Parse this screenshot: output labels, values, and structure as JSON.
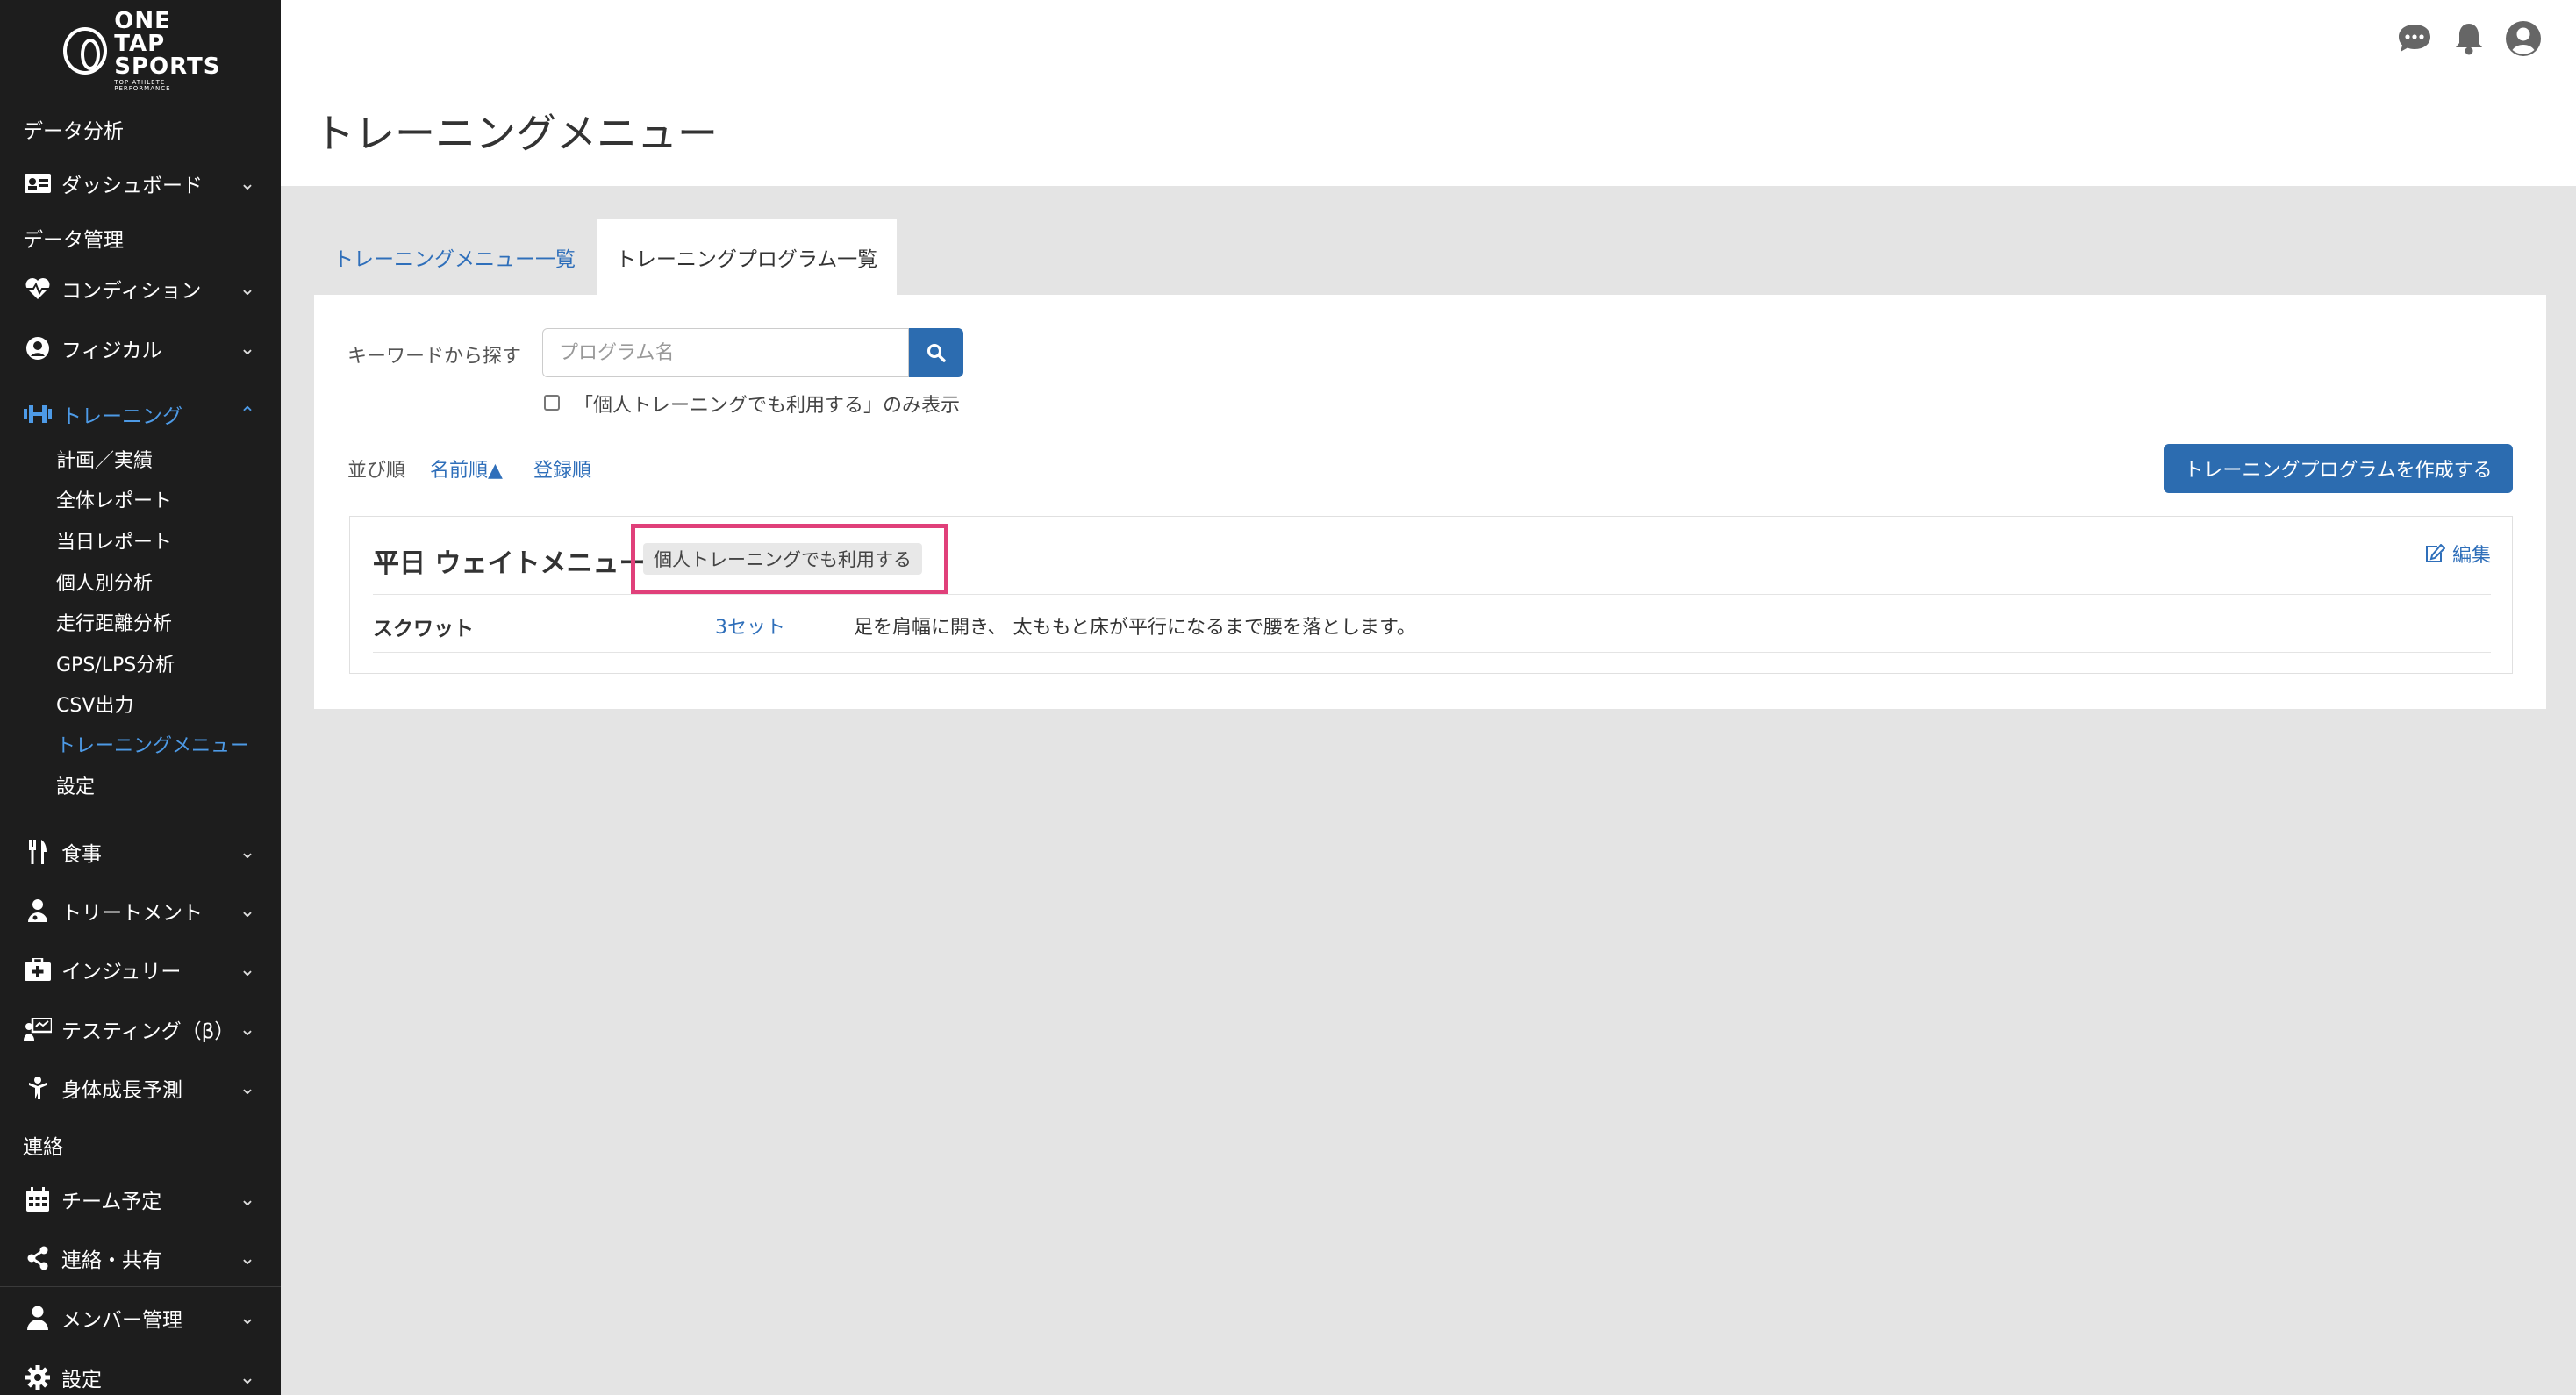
{
  "brand": {
    "line1": "ONE TAP",
    "line2": "SPORTS",
    "tagline": "TOP ATHLETE PERFORMANCE"
  },
  "sidebar": {
    "section_data_analysis": "データ分析",
    "dashboard": "ダッシュボード",
    "section_data_management": "データ管理",
    "condition": "コンディション",
    "physical": "フィジカル",
    "training": "トレーニング",
    "training_sub": [
      "計画／実績",
      "全体レポート",
      "当日レポート",
      "個人別分析",
      "走行距離分析",
      "GPS/LPS分析",
      "CSV出力",
      "トレーニングメニュー",
      "設定"
    ],
    "meal": "食事",
    "treatment": "トリートメント",
    "injury": "インジュリー",
    "testing": "テスティング（β）",
    "growth": "身体成長予測",
    "section_contact": "連絡",
    "team_schedule": "チーム予定",
    "contact_share": "連絡・共有",
    "member_management": "メンバー管理",
    "settings": "設定"
  },
  "header": {
    "page_title": "トレーニングメニュー"
  },
  "tabs": [
    {
      "label": "トレーニングメニュー一覧"
    },
    {
      "label": "トレーニングプログラム一覧"
    }
  ],
  "search": {
    "label": "キーワードから探す",
    "placeholder": "プログラム名",
    "filter_label": "「個人トレーニングでも利用する」のみ表示"
  },
  "sort": {
    "label": "並び順",
    "by_name": "名前順▲",
    "by_registered": "登録順"
  },
  "create_button": "トレーニングプログラムを作成する",
  "program": {
    "title": "平日 ウェイトメニュー",
    "badge": "個人トレーニングでも利用する",
    "edit_label": "編集",
    "exercise": {
      "name": "スクワット",
      "sets": "3セット",
      "description": "足を肩幅に開き、 太ももと床が平行になるまで腰を落とします。"
    }
  },
  "colors": {
    "accent": "#2c6cb0",
    "highlight": "#e0407a",
    "sidebar_bg": "#1d1d1d"
  }
}
